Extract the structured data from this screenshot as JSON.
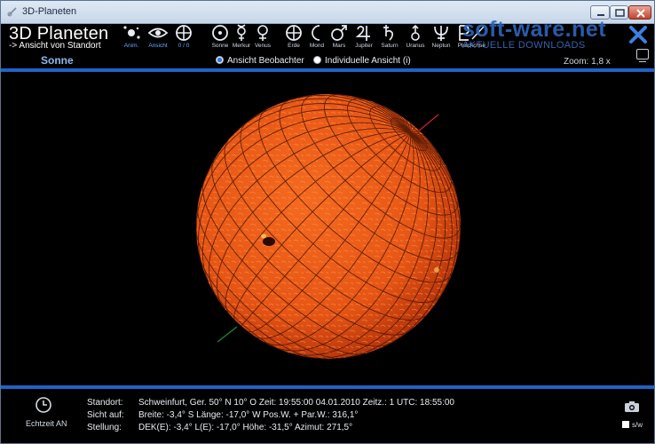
{
  "window": {
    "title": "3D-Planeten"
  },
  "brand": {
    "title": "3D Planeten",
    "subtitle": "-> Ansicht von Standort"
  },
  "tools": [
    {
      "id": "anim",
      "label": "Anim.",
      "icon": "animation-icon",
      "active": true
    },
    {
      "id": "ansicht",
      "label": "Ansicht",
      "icon": "eye-icon",
      "active": true
    },
    {
      "id": "reset",
      "label": "0 / 0",
      "icon": "crosshair-icon",
      "active": true
    },
    {
      "id": "sonne",
      "label": "Sonne",
      "icon": "sun-symbol-icon"
    },
    {
      "id": "merkur",
      "label": "Merkur",
      "icon": "mercury-symbol-icon"
    },
    {
      "id": "venus",
      "label": "Venus",
      "icon": "venus-symbol-icon"
    },
    {
      "id": "erde",
      "label": "Erde",
      "icon": "earth-symbol-icon"
    },
    {
      "id": "mond",
      "label": "Mond",
      "icon": "moon-symbol-icon"
    },
    {
      "id": "mars",
      "label": "Mars",
      "icon": "mars-symbol-icon"
    },
    {
      "id": "jupiter",
      "label": "Jupiter",
      "icon": "jupiter-symbol-icon"
    },
    {
      "id": "saturn",
      "label": "Saturn",
      "icon": "saturn-symbol-icon"
    },
    {
      "id": "uranus",
      "label": "Uranus",
      "icon": "uranus-symbol-icon"
    },
    {
      "id": "neptun",
      "label": "Neptun",
      "icon": "neptune-symbol-icon"
    },
    {
      "id": "pluto",
      "label": "Pluto",
      "icon": "pluto-symbol-icon"
    },
    {
      "id": "achse",
      "label": "Achse",
      "icon": "axis-icon"
    }
  ],
  "watermark": {
    "main": "soft-ware.net",
    "sub": "AKTUELLE DOWNLOADS"
  },
  "current_body": "Sonne",
  "view_modes": {
    "observer": "Ansicht Beobachter",
    "individual": "Individuelle Ansicht  (i)",
    "selected": "observer"
  },
  "zoom": "Zoom:  1,8 x",
  "colors": {
    "accent": "#1f63c7",
    "sun": "#e8561a"
  },
  "status": {
    "realtime_label": "Echtzeit AN",
    "rows": [
      {
        "key": "Standort:",
        "value": "Schweinfurt, Ger. 50° N   10° O  Zeit:  19:55:00   04.01.2010   Zeitz.: 1   UTC: 18:55:00"
      },
      {
        "key": "Sicht auf:",
        "value": "Breite:  -3,4° S        Länge:  -17,0° W     Pos.W. + Par.W.:  316,1°"
      },
      {
        "key": "Stellung:",
        "value": "DEK(E):  -3,4°    L(E):  -17,0°    Höhe:  -31,5°    Azimut:  271,5°"
      }
    ],
    "sw_label": "s/w"
  }
}
